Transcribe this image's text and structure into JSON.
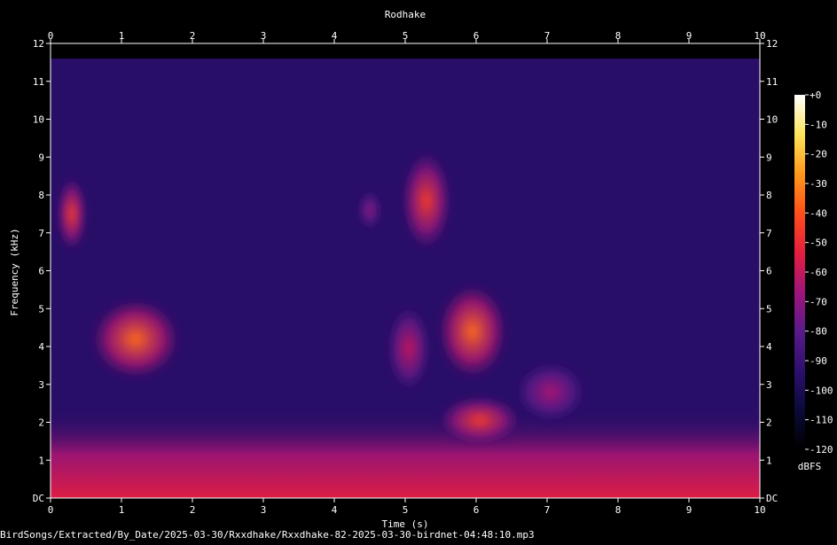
{
  "source_path": "BirdSongs/Extracted/By_Date/2025-03-30/Rxxdhake/Rxxdhake-82-2025-03-30-birdnet-04:48:10.mp3",
  "colors": {
    "background": "#000000",
    "palette": [
      "#000000",
      "#0a0a3a",
      "#2d0f6e",
      "#5a1a8a",
      "#a0147a",
      "#e61e3c",
      "#ff4e1a",
      "#ff9a1a",
      "#ffe45a",
      "#ffffff"
    ]
  },
  "chart_data": {
    "type": "heatmap",
    "title": "Rodhake",
    "xlabel": "Time (s)",
    "ylabel": "Frequency (kHz)",
    "xlim": [
      0,
      10
    ],
    "ylim": [
      0,
      12
    ],
    "x_ticks": [
      "0",
      "1",
      "2",
      "3",
      "4",
      "5",
      "6",
      "7",
      "8",
      "9",
      "10"
    ],
    "y_ticks": [
      "DC",
      "1",
      "2",
      "3",
      "4",
      "5",
      "6",
      "7",
      "8",
      "9",
      "10",
      "11",
      "12"
    ],
    "colorbar": {
      "label": "dBFS",
      "range": [
        -120,
        0
      ],
      "ticks": [
        "+0",
        "-10",
        "-20",
        "-30",
        "-40",
        "-50",
        "-60",
        "-70",
        "-80",
        "-90",
        "-100",
        "-110",
        "-120"
      ]
    },
    "background_level_dbfs": -95,
    "low_frequency_band": {
      "freq_khz": [
        0,
        2
      ],
      "level_dbfs": -55
    },
    "energy_blobs": [
      {
        "t": [
          0.15,
          0.45
        ],
        "f_khz": [
          6.6,
          8.4
        ],
        "peak_dbfs": -45
      },
      {
        "t": [
          0.6,
          1.8
        ],
        "f_khz": [
          3.2,
          5.2
        ],
        "peak_dbfs": -35
      },
      {
        "t": [
          4.4,
          4.6
        ],
        "f_khz": [
          7.2,
          8.0
        ],
        "peak_dbfs": -70
      },
      {
        "t": [
          4.8,
          5.3
        ],
        "f_khz": [
          2.9,
          5.0
        ],
        "peak_dbfs": -60
      },
      {
        "t": [
          5.0,
          5.6
        ],
        "f_khz": [
          6.6,
          9.1
        ],
        "peak_dbfs": -45
      },
      {
        "t": [
          5.5,
          6.4
        ],
        "f_khz": [
          3.2,
          5.6
        ],
        "peak_dbfs": -35
      },
      {
        "t": [
          5.5,
          6.6
        ],
        "f_khz": [
          1.5,
          2.6
        ],
        "peak_dbfs": -45
      },
      {
        "t": [
          6.6,
          7.5
        ],
        "f_khz": [
          2.1,
          3.5
        ],
        "peak_dbfs": -65
      }
    ]
  }
}
